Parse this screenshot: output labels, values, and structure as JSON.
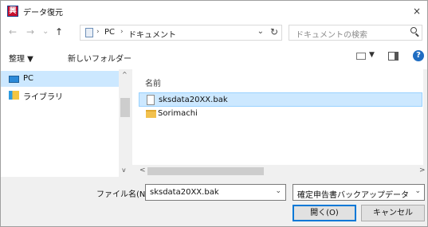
{
  "window": {
    "title": "データ復元",
    "app_icon_glyph": "興",
    "close_glyph": "×"
  },
  "nav": {
    "back": "←",
    "forward": "→",
    "recent": "⌄",
    "up": "↑",
    "breadcrumb": [
      "PC",
      "ドキュメント"
    ],
    "sep": "›",
    "dropdown": "⌄",
    "refresh": "↻",
    "search_placeholder": "ドキュメントの検索"
  },
  "toolbar": {
    "organize": "整理 ▼",
    "new_folder": "新しいフォルダー",
    "view_dropdown": "▼",
    "help": "?"
  },
  "sidebar": {
    "items": [
      {
        "label": "PC",
        "icon": "pc-icon"
      },
      {
        "label": "ライブラリ",
        "icon": "library-icon"
      }
    ]
  },
  "filelist": {
    "column_name": "名前",
    "items": [
      {
        "name": "sksdata20XX.bak",
        "type": "file"
      },
      {
        "name": "Sorimachi",
        "type": "folder"
      }
    ]
  },
  "scroll": {
    "up": "^",
    "down": "v",
    "left": "<",
    "right": ">"
  },
  "bottom": {
    "filename_label": "ファイル名(N):",
    "filename_value": "sksdata20XX.bak",
    "filename_dropdown": "⌄",
    "filetype_value": "確定申告書バックアップデータ (*.bak)",
    "filetype_dropdown": "⌄",
    "open_button": "開く(O)",
    "cancel_button": "キャンセル"
  },
  "colors": {
    "selection": "#cce8ff",
    "accent": "#0078d7",
    "title_icon": "#c8102e"
  }
}
